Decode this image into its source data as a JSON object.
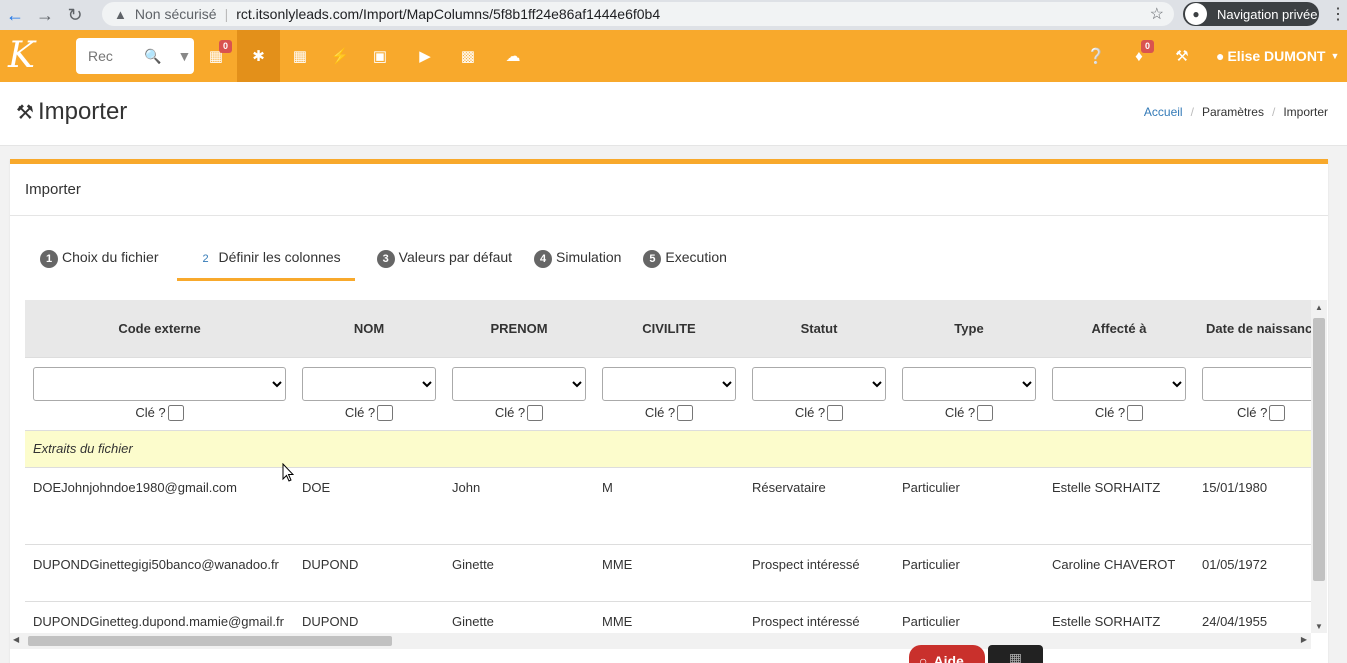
{
  "browser": {
    "insecure_label": "Non sécurisé",
    "url": "rct.itsonlyleads.com/Import/MapColumns/5f8b1ff24e86af1444e6f0b4",
    "private_label": "Navigation privée"
  },
  "navbar": {
    "search_placeholder": "Rec",
    "calendar_badge": "0",
    "notif_badge": "0",
    "user_name": "Elise DUMONT"
  },
  "page": {
    "title": "Importer",
    "breadcrumb": [
      "Accueil",
      "Paramètres",
      "Importer"
    ],
    "breadcrumb_divider": "/"
  },
  "panel": {
    "title": "Importer",
    "steps": [
      {
        "num": "1",
        "label": "Choix du fichier"
      },
      {
        "num": "2",
        "label": "Définir les colonnes"
      },
      {
        "num": "3",
        "label": "Valeurs par défaut"
      },
      {
        "num": "4",
        "label": "Simulation"
      },
      {
        "num": "5",
        "label": "Execution"
      }
    ]
  },
  "table": {
    "columns": [
      "Code externe",
      "NOM",
      "PRENOM",
      "CIVILITE",
      "Statut",
      "Type",
      "Affecté à",
      "Date de naissance"
    ],
    "key_label": "Clé ?",
    "extract_label": "Extraits du fichier",
    "rows": [
      [
        "DOEJohnjohndoe1980@gmail.com",
        "DOE",
        "John",
        "M",
        "Réservataire",
        "Particulier",
        "Estelle SORHAITZ",
        "15/01/1980"
      ],
      [
        "DUPONDGinettegigi50banco@wanadoo.fr",
        "DUPOND",
        "Ginette",
        "MME",
        "Prospect intéressé",
        "Particulier",
        "Caroline CHAVEROT",
        "01/05/1972"
      ],
      [
        "DUPONDGinetteg.dupond.mamie@gmail.fr",
        "DUPOND",
        "Ginette",
        "MME",
        "Prospect intéressé",
        "Particulier",
        "Estelle SORHAITZ",
        "24/04/1955"
      ]
    ]
  },
  "floating": {
    "help_label": "Aide"
  }
}
